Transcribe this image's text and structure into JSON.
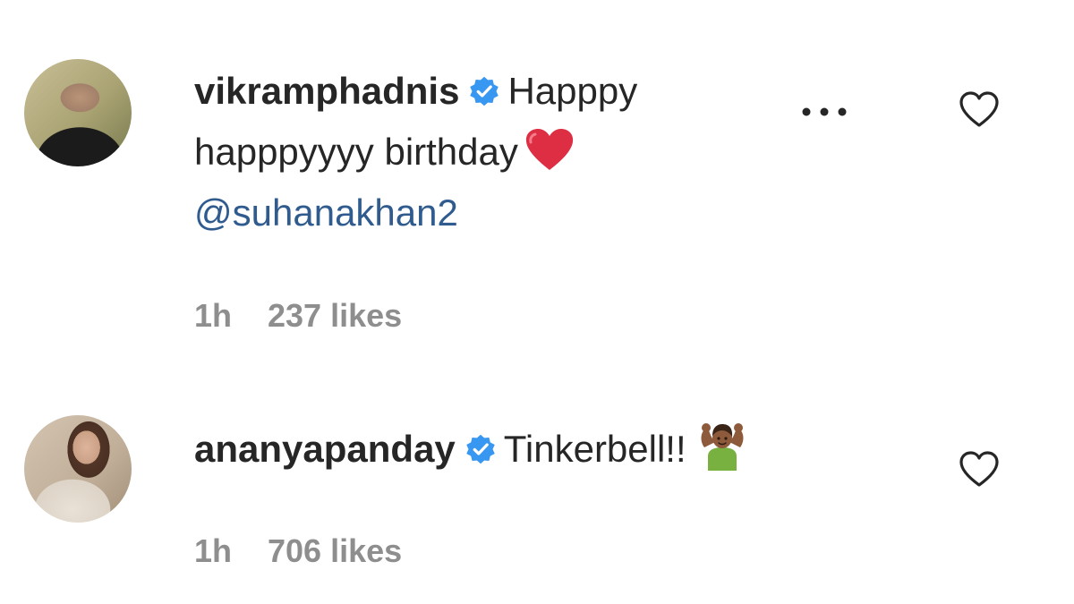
{
  "comments": [
    {
      "username": "vikramphadnis",
      "verified": true,
      "text_before": "Happpy happpyyyy birthday",
      "emoji": "red-heart",
      "mention": "@suhanakhan2",
      "time": "1h",
      "likes": "237 likes",
      "more_icon": "ellipsis-icon",
      "like_icon": "heart-outline-icon"
    },
    {
      "username": "ananyapanday",
      "verified": true,
      "text_before": "Tinkerbell!!",
      "emoji": "person-gesturing-ok",
      "time": "1h",
      "likes": "706 likes",
      "like_icon": "heart-outline-icon"
    }
  ],
  "colors": {
    "verified_badge": "#3897f0",
    "mention": "#2f5b8e",
    "meta_text": "#8e8e8e",
    "body_text": "#262626"
  }
}
